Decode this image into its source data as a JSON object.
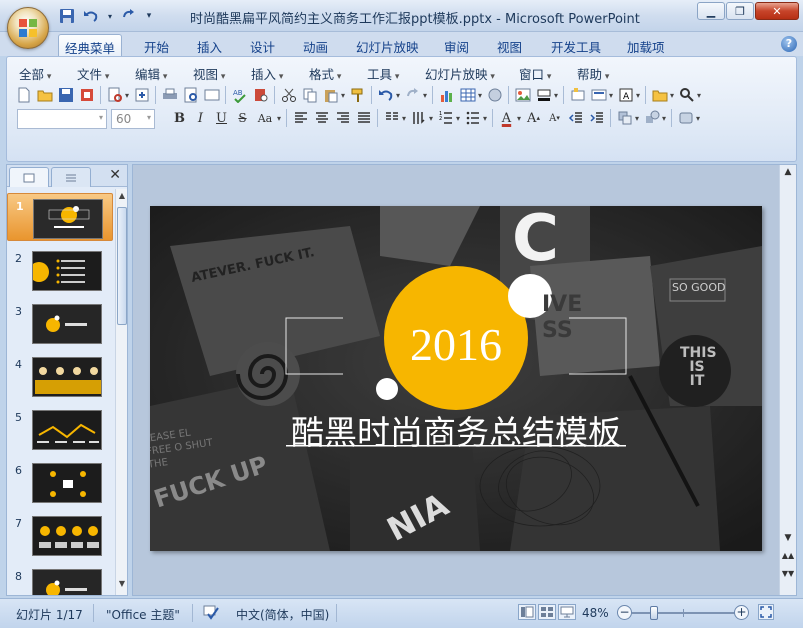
{
  "window": {
    "title": "时尚酷黑扁平风简约主义商务工作汇报ppt模板.pptx - Microsoft PowerPoint"
  },
  "ribbon_tabs": [
    "经典菜单",
    "开始",
    "插入",
    "设计",
    "动画",
    "幻灯片放映",
    "审阅",
    "视图",
    "开发工具",
    "加载项"
  ],
  "active_tab": "经典菜单",
  "classic_menu": [
    "全部",
    "文件",
    "编辑",
    "视图",
    "插入",
    "格式",
    "工具",
    "幻灯片放映",
    "窗口",
    "帮助"
  ],
  "font": {
    "name": "",
    "size": "60"
  },
  "panel": {
    "close_label": "✕",
    "thumbnails": [
      {
        "num": "1"
      },
      {
        "num": "2"
      },
      {
        "num": "3"
      },
      {
        "num": "4"
      },
      {
        "num": "5"
      },
      {
        "num": "6"
      },
      {
        "num": "7"
      },
      {
        "num": "8"
      }
    ]
  },
  "slide": {
    "year": "2016",
    "title": "酷黑时尚商务总结模板",
    "bg_text_1": "ATEVER. FUCK IT.",
    "bg_text_2": "SO GOOD",
    "bg_text_3": "THIS IS IT",
    "bg_text_4": "FUCK UP",
    "bg_text_5": "LEASE EL FREE O SHUT THE",
    "bg_text_6": "NIA",
    "bg_text_7": "C",
    "bg_text_8": "IVE SS",
    "accent": "#f7b600"
  },
  "status": {
    "slide_info": "幻灯片 1/17",
    "theme": "\"Office 主题\"",
    "language": "中文(简体，中国)",
    "zoom": "48%",
    "zoom_level": 0.48
  }
}
